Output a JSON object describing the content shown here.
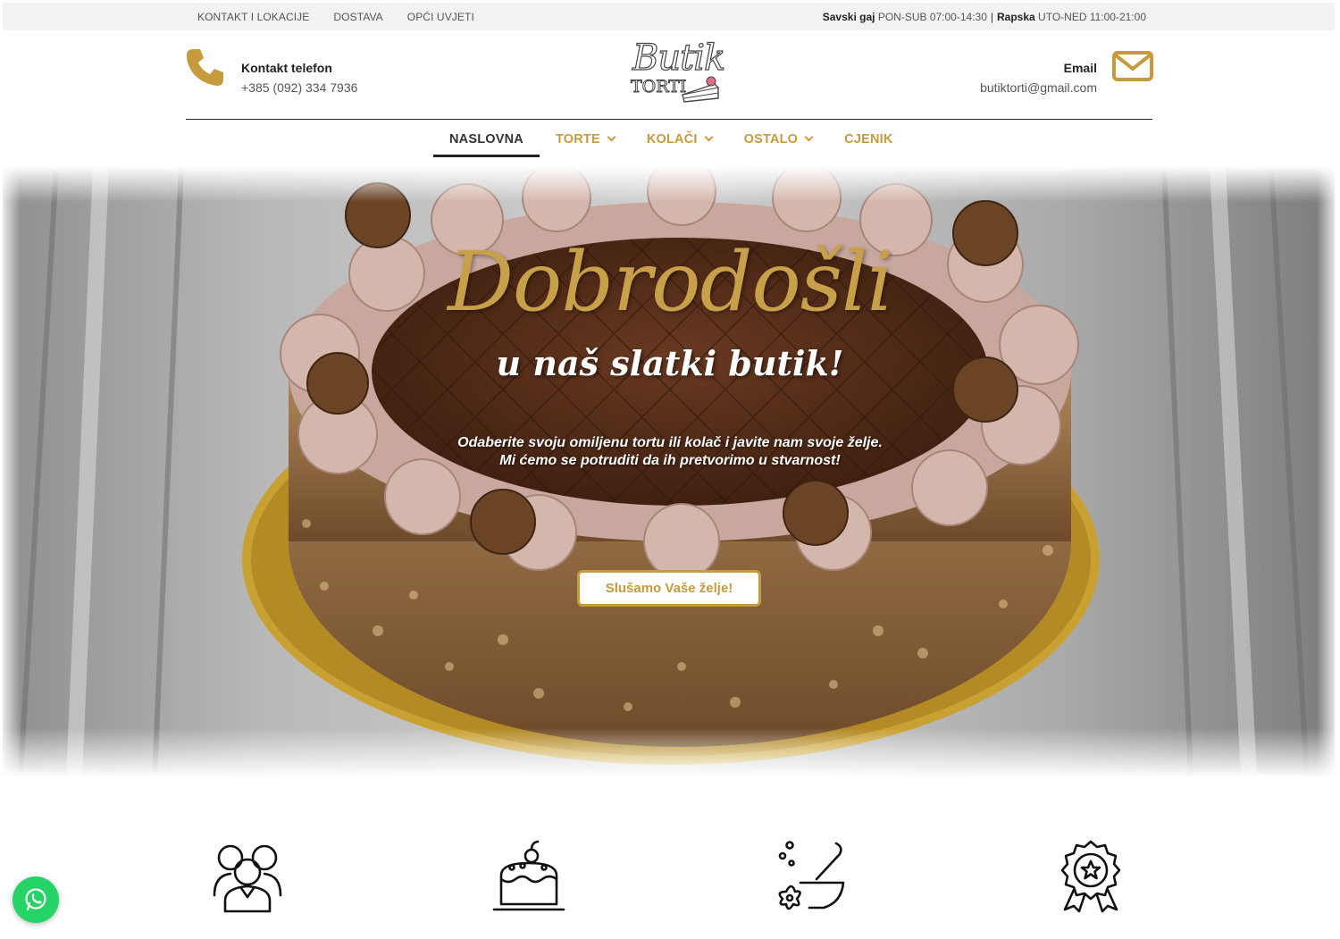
{
  "topbar": {
    "links": [
      "KONTAKT I LOKACIJE",
      "DOSTAVA",
      "OPĆI UVJETI"
    ],
    "hours": [
      {
        "location": "Savski gaj",
        "time": "PON-SUB 07:00-14:30"
      },
      {
        "location": "Rapska",
        "time": "UTO-NED 11:00-21:00"
      }
    ],
    "separator": "|"
  },
  "header": {
    "phone": {
      "label": "Kontakt telefon",
      "value": "+385 (092) 334 7936",
      "icon": "phone-icon"
    },
    "email": {
      "label": "Email",
      "value": "butiktorti@gmail.com",
      "icon": "envelope-icon"
    },
    "logo": {
      "line1": "Butik",
      "line2": "TORTI"
    }
  },
  "nav": {
    "items": [
      {
        "label": "NASLOVNA",
        "active": true,
        "dropdown": false
      },
      {
        "label": "TORTE",
        "active": false,
        "dropdown": true
      },
      {
        "label": "KOLAČI",
        "active": false,
        "dropdown": true
      },
      {
        "label": "OSTALO",
        "active": false,
        "dropdown": true
      },
      {
        "label": "CJENIK",
        "active": false,
        "dropdown": false
      }
    ]
  },
  "hero": {
    "title": "Dobrodošli",
    "subtitle": "u naš slatki butik!",
    "text_line1": "Odaberite svoju omiljenu tortu ili kolač i javite nam svoje želje.",
    "text_line2": "Mi ćemo se potruditi da ih pretvorimo u stvarnost!",
    "button": "Slušamo Vaše želje!"
  },
  "features": [
    {
      "icon": "people-icon"
    },
    {
      "icon": "cake-icon"
    },
    {
      "icon": "mortar-pestle-icon"
    },
    {
      "icon": "award-badge-icon"
    }
  ],
  "colors": {
    "accent": "#c79a3e",
    "topbar_bg": "#f2f2f2",
    "text_dark": "#222222",
    "whatsapp": "#25d366"
  }
}
